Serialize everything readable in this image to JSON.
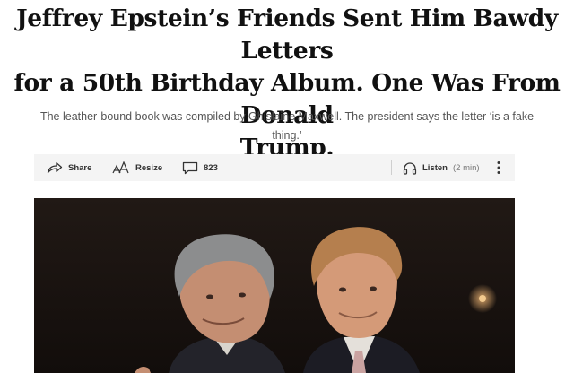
{
  "article": {
    "headline_lines": [
      "Jeffrey Epstein’s Friends Sent Him Bawdy Letters",
      "for a 50th Birthday Album. One Was From Donald",
      "Trump."
    ],
    "dek_lines": [
      "The leather-bound book was compiled by Ghislaine Maxwell. The president says the letter ‘is a fake",
      "thing.’"
    ]
  },
  "toolbar": {
    "share_label": "Share",
    "resize_label": "Resize",
    "comment_count": "823",
    "listen_label": "Listen",
    "listen_duration": "(2 min)"
  },
  "icons": {
    "share": "share-arrow-icon",
    "resize": "font-resize-icon",
    "comments": "speech-bubble-icon",
    "listen": "headphones-icon",
    "more": "vertical-ellipsis-icon"
  },
  "colors": {
    "headline": "#111111",
    "dek": "#555555",
    "toolbar_bg": "#f4f4f4",
    "photo_bg": "#1a1412"
  }
}
